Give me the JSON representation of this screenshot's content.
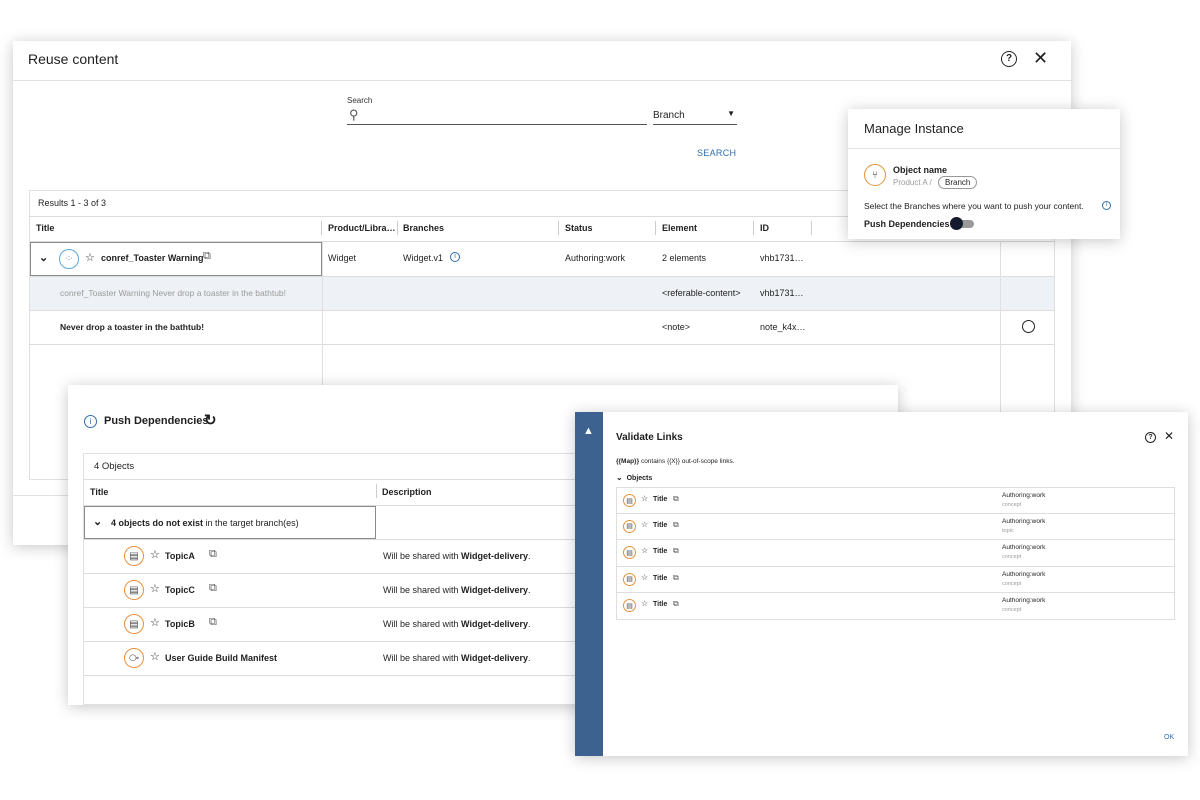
{
  "reuse": {
    "title": "Reuse content",
    "search_label": "Search",
    "branch_select": "Branch",
    "search_button": "SEARCH",
    "results_count": "Results 1 - 3 of 3",
    "columns": [
      "Title",
      "Product/Libra…",
      "Branches",
      "Status",
      "Element",
      "ID"
    ],
    "rows": [
      {
        "title": "conref_Toaster Warning",
        "product": "Widget",
        "branch": "Widget.v1",
        "status": "Authoring:work",
        "element": "2 elements",
        "id": "vhb1731…"
      },
      {
        "title": "conref_Toaster Warning Never drop a toaster in the bathtub!",
        "element": "<referable-content>",
        "id": "vhb1731…"
      },
      {
        "title": "Never drop a toaster in the bathtub!",
        "element": "<note>",
        "id": "note_k4x…"
      }
    ]
  },
  "manage": {
    "title": "Manage Instance",
    "object_name": "Object name",
    "path_prefix": "Product A /",
    "branch_chip": "Branch",
    "instruction": "Select the Branches where you want to push your content.",
    "push_label": "Push Dependencies"
  },
  "push": {
    "title": "Push Dependencies",
    "count": "4 Objects",
    "col_title": "Title",
    "col_desc": "Description",
    "group_bold": "4 objects do not exist",
    "group_rest": "in the target branch(es)",
    "desc_prefix": "Will be shared with",
    "desc_target": "Widget-delivery",
    "desc_suffix": ".",
    "items": [
      {
        "name": "TopicA",
        "icon": "document-icon"
      },
      {
        "name": "TopicC",
        "icon": "document-icon"
      },
      {
        "name": "TopicB",
        "icon": "document-icon"
      },
      {
        "name": "User Guide Build Manifest",
        "icon": "map-icon"
      }
    ]
  },
  "validate": {
    "title": "Validate Links",
    "message_bold": "{{Map}}",
    "message_rest": "contains {{X}} out-of-scope links.",
    "objects_label": "Objects",
    "items": [
      {
        "title": "Title",
        "status": "Authoring:work",
        "type": "concept"
      },
      {
        "title": "Title",
        "status": "Authoring:work",
        "type": "topic"
      },
      {
        "title": "Title",
        "status": "Authoring:work",
        "type": "concept"
      },
      {
        "title": "Title",
        "status": "Authoring:work",
        "type": "concept"
      },
      {
        "title": "Title",
        "status": "Authoring:work",
        "type": "concept"
      }
    ],
    "ok": "OK"
  },
  "colors": {
    "accent_blue": "#2f6fb0",
    "sidebar_blue": "#3d6290",
    "orange": "#e6913a",
    "selected_row": "#eef1f5"
  }
}
